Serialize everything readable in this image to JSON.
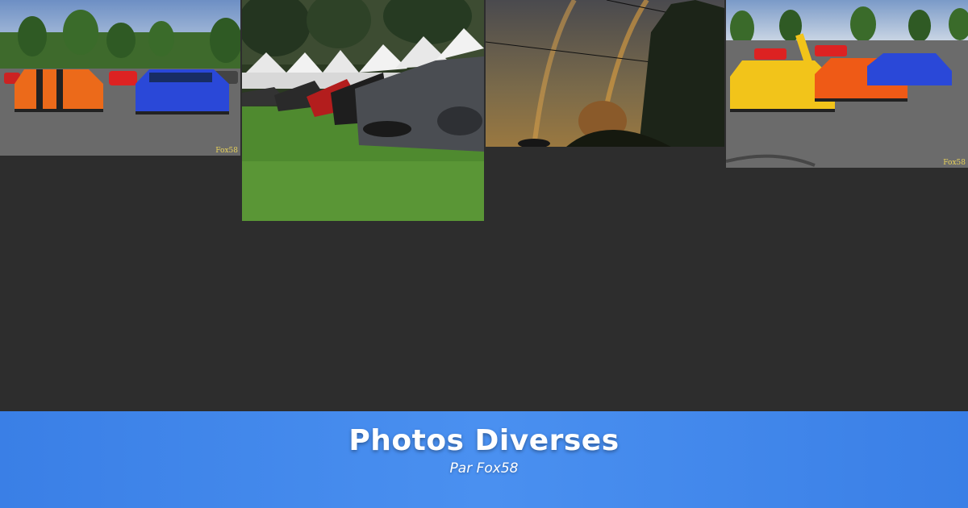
{
  "gallery": {
    "photos": [
      {
        "alt": "Lamborghini orange et bleue sur parking",
        "watermark": "Fox58"
      },
      {
        "alt": "Ferrari grise devant des tentes blanches",
        "watermark": ""
      },
      {
        "alt": "Double arc-en-ciel au coucher du soleil",
        "watermark": ""
      },
      {
        "alt": "Lamborghini jaune, orange et bleue",
        "watermark": "Fox58"
      }
    ]
  },
  "banner": {
    "title": "Photos Diverses",
    "subtitle": "Par Fox58"
  },
  "colors": {
    "background": "#2d2d2d",
    "banner": "#4a90f0",
    "watermark": "#e8d25a"
  }
}
